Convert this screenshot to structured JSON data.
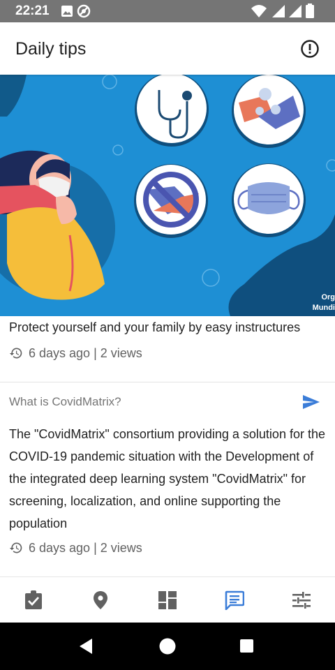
{
  "status_bar": {
    "time": "22:21",
    "left_icons": [
      "image-icon",
      "do-not-disturb-icon"
    ],
    "right_icons": [
      "wifi-icon",
      "cellular-signal-icon",
      "cellular-signal-icon",
      "battery-icon"
    ]
  },
  "app_bar": {
    "title": "Daily tips",
    "action_icon": "info-icon"
  },
  "cards": [
    {
      "image": "covid-prevention-illustration",
      "image_brand_text": [
        "Org",
        "Mundi"
      ],
      "caption": "Protect yourself and your family by easy instructures",
      "meta": "6 days ago | 2 views"
    },
    {
      "title": "What is CovidMatrix?",
      "body": "The \"CovidMatrix\" consortium providing a solution for the COVID-19 pandemic situation with the Development of the integrated deep learning system \"CovidMatrix\" for screening, localization, and online supporting the population",
      "meta": "6 days ago | 2 views",
      "action_icon": "send-icon"
    }
  ],
  "bottom_nav": {
    "items": [
      {
        "icon": "assignment-check-icon",
        "active": false
      },
      {
        "icon": "location-pin-icon",
        "active": false
      },
      {
        "icon": "dashboard-icon",
        "active": false
      },
      {
        "icon": "chat-icon",
        "active": true
      },
      {
        "icon": "tune-icon",
        "active": false
      }
    ]
  },
  "colors": {
    "active": "#3b7dd8",
    "inactive": "#616161",
    "banner_blue": "#1e8fd4",
    "status_bar": "#757575"
  }
}
